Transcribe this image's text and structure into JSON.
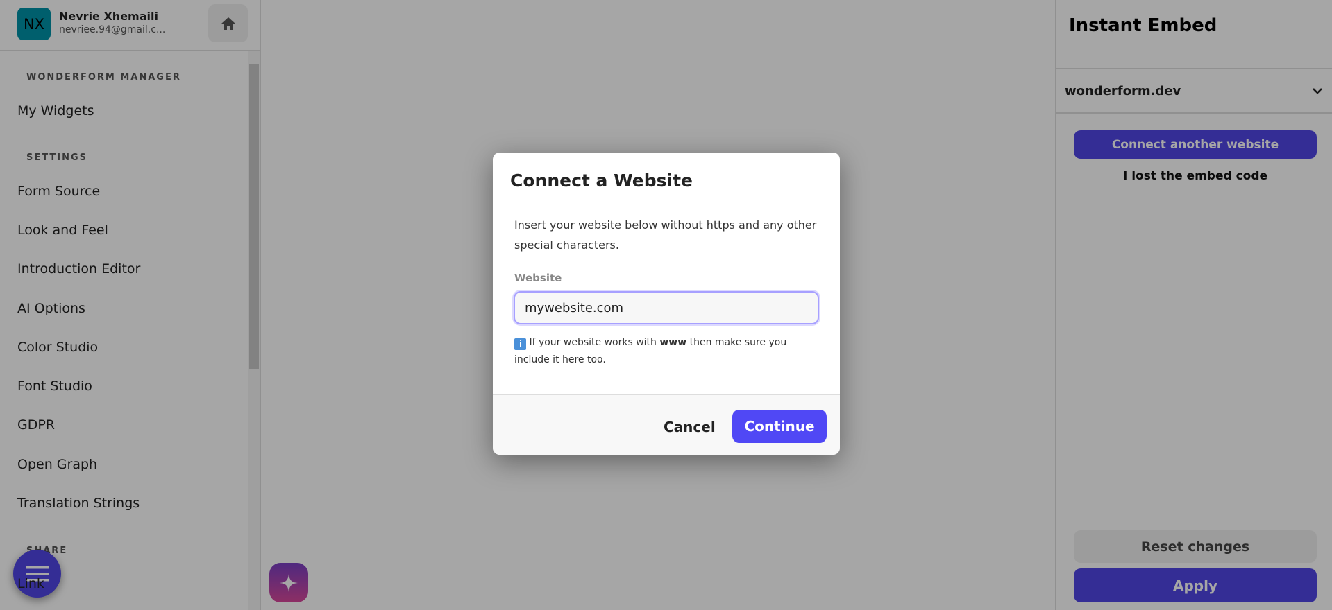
{
  "user": {
    "initials": "NX",
    "name": "Nevrie Xhemaili",
    "email": "nevriee.94@gmail.c..."
  },
  "sidebar": {
    "sections": [
      {
        "label": "WONDERFORM MANAGER"
      },
      {
        "label": "SETTINGS"
      },
      {
        "label": "SHARE"
      }
    ],
    "items": [
      {
        "label": "My Widgets"
      },
      {
        "label": "Form Source"
      },
      {
        "label": "Look and Feel"
      },
      {
        "label": "Introduction Editor"
      },
      {
        "label": "AI Options"
      },
      {
        "label": "Color Studio"
      },
      {
        "label": "Font Studio"
      },
      {
        "label": "GDPR"
      },
      {
        "label": "Open Graph"
      },
      {
        "label": "Translation Strings"
      },
      {
        "label": "Link"
      }
    ]
  },
  "panel": {
    "title": "Instant Embed",
    "selected_site": "wonderform.dev",
    "connect_label": "Connect another website",
    "lost_label": "I lost the embed code",
    "reset_label": "Reset changes",
    "apply_label": "Apply"
  },
  "modal": {
    "title": "Connect a Website",
    "description": "Insert your website below without https and any other special characters.",
    "field_label": "Website",
    "field_value": "mywebsite.com",
    "note_pre": "If your website works with ",
    "note_bold": "www",
    "note_post": " then make sure you include it here too.",
    "cancel_label": "Cancel",
    "continue_label": "Continue"
  },
  "colors": {
    "accent": "#5046e5",
    "avatar": "#0093a8"
  }
}
